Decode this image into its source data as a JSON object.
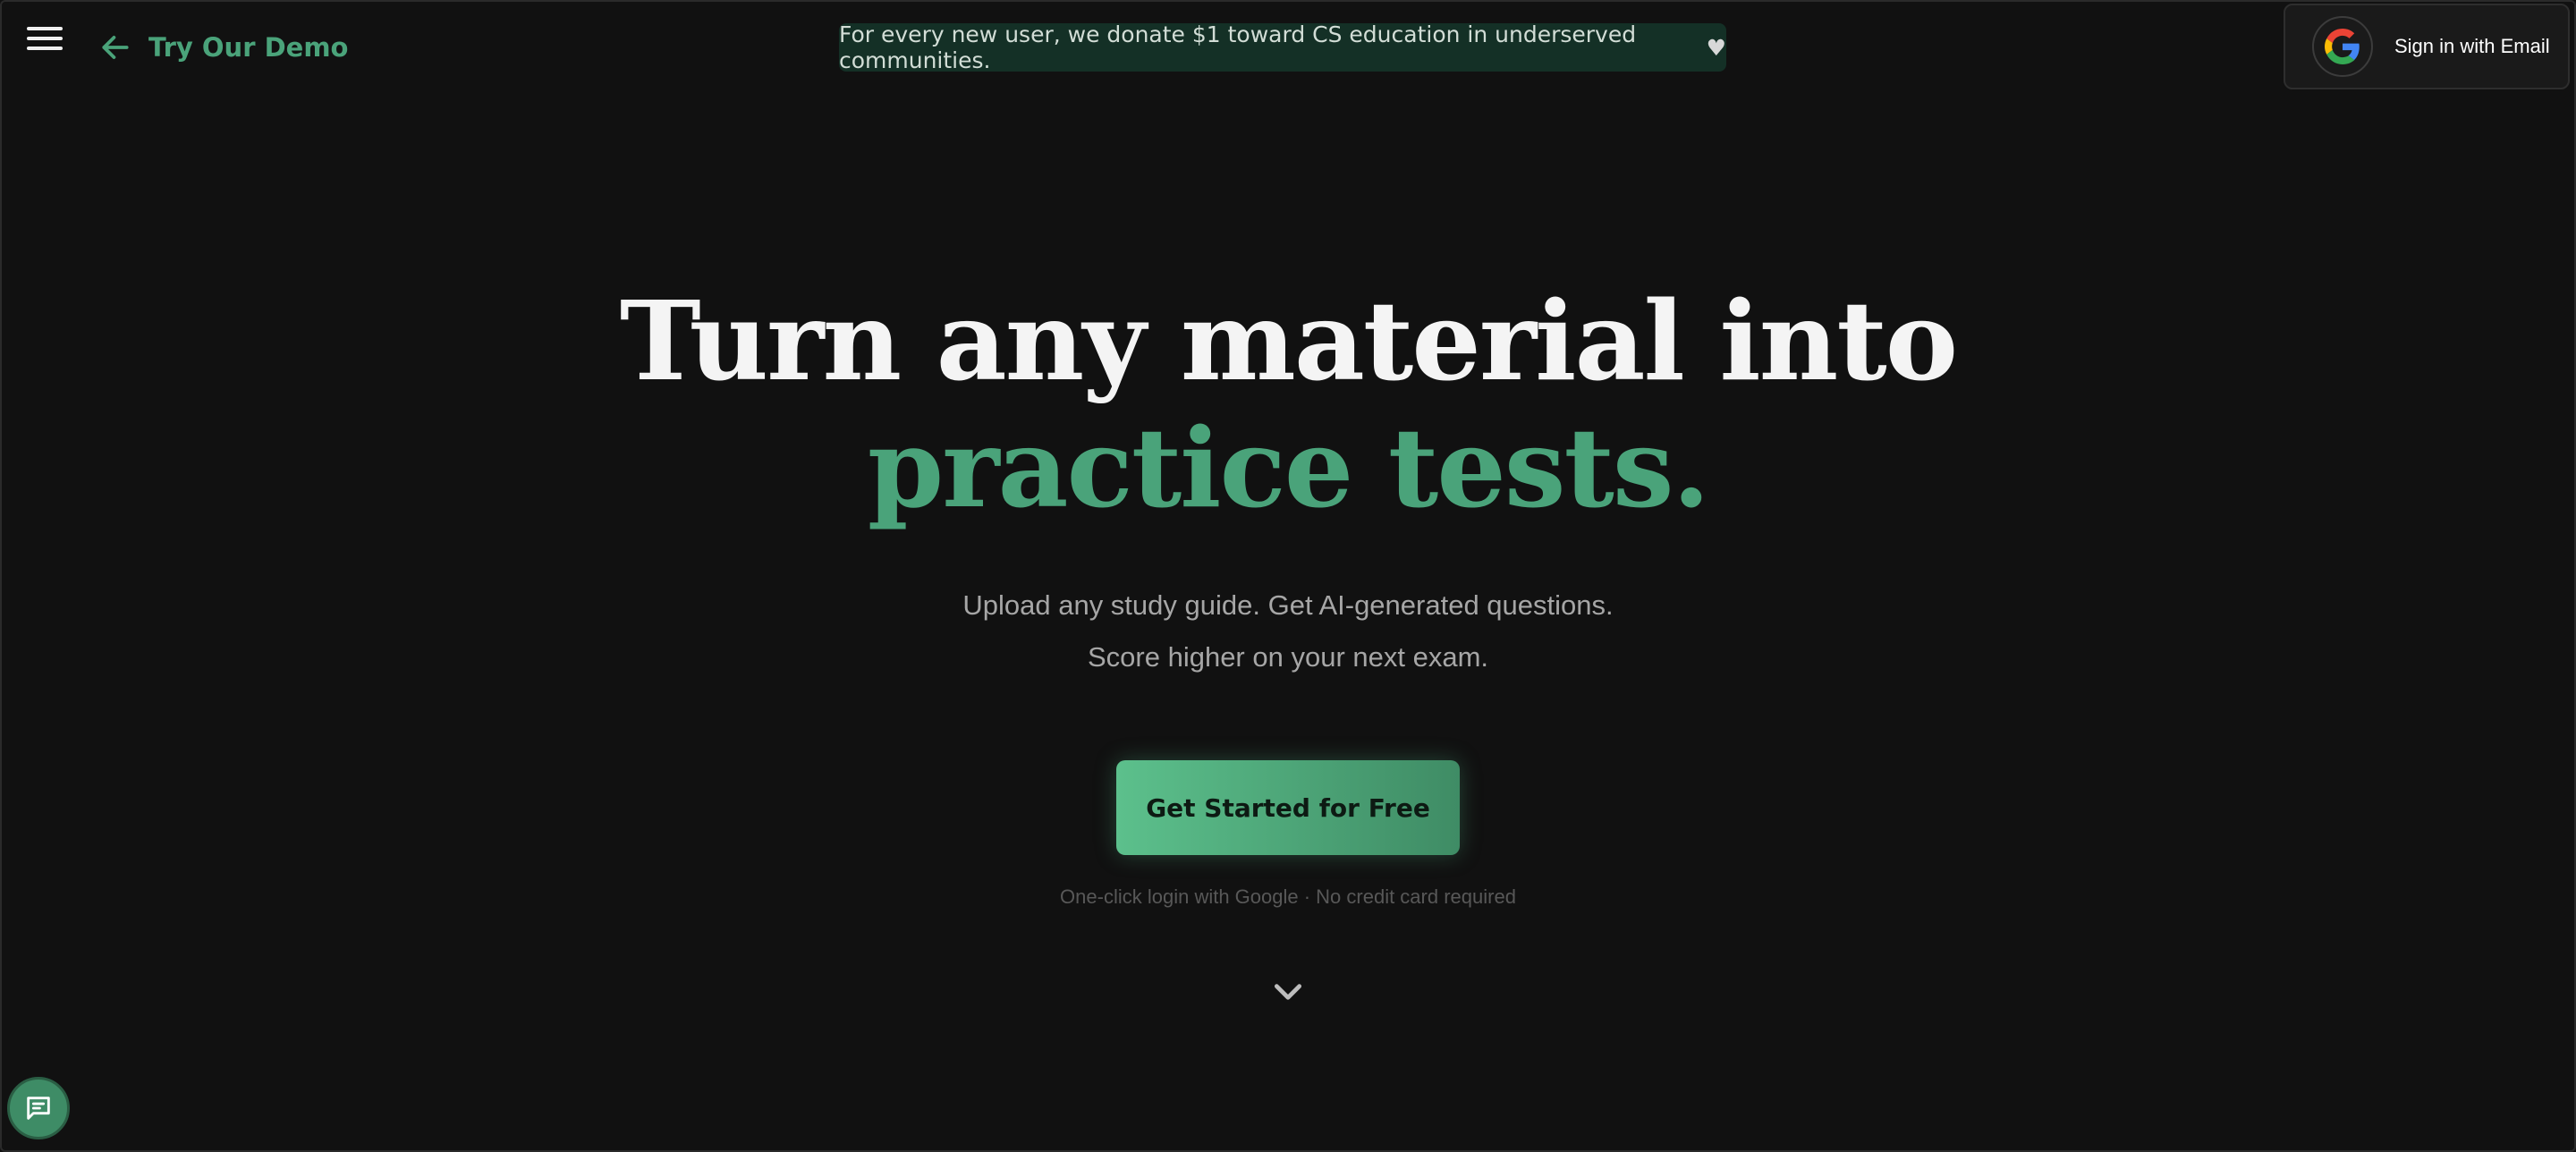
{
  "header": {
    "menu_icon": "hamburger-menu-icon",
    "back_icon": "arrow-left-icon",
    "demo_link_label": "Try Our Demo",
    "banner_text": "For every new user, we donate $1 toward CS education in underserved communities.",
    "banner_heart": "♥",
    "signin_label": "Sign in with Email",
    "signin_icon": "google-logo-icon"
  },
  "hero": {
    "headline_line1": "Turn any material into",
    "headline_line2": "practice tests.",
    "subtitle_line1": "Upload any study guide. Get AI-generated questions.",
    "subtitle_line2": "Score higher on your next exam.",
    "cta_label": "Get Started for Free",
    "note": "One-click login with Google · No credit card required",
    "scroll_icon": "chevron-down-icon"
  },
  "chat": {
    "icon": "chat-message-icon"
  },
  "colors": {
    "background": "#111111",
    "accent": "#4aa37a",
    "banner_bg": "#143026",
    "headline": "#f4f4f4",
    "subtitle": "#a6a6a6"
  }
}
